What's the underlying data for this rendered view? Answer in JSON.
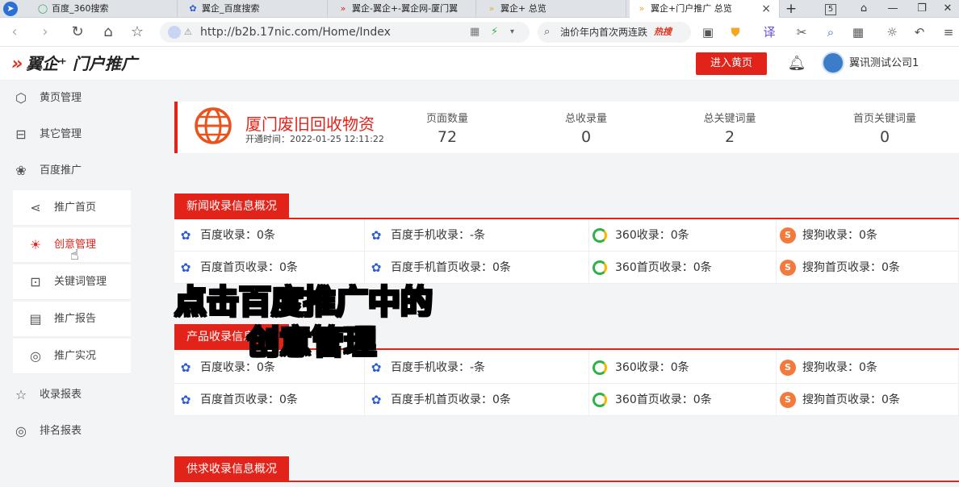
{
  "browser": {
    "tabs": [
      {
        "label": "百度_360搜索",
        "icon": "360-icon"
      },
      {
        "label": "翼企_百度搜索",
        "icon": "baidu-icon"
      },
      {
        "label": "翼企-翼企+-翼企网-厦门翼",
        "icon": "yiqi-icon"
      },
      {
        "label": "翼企+ 总览",
        "icon": "yiqi-icon"
      },
      {
        "label": "翼企+门户推广 总览",
        "icon": "yiqi-icon",
        "active": true
      }
    ],
    "tab_counter": "5",
    "url": "http://b2b.17nic.com/Home/Index",
    "search_text": "油价年内首次两连跌",
    "search_hot": "热搜"
  },
  "header": {
    "logo_text": "翼企⁺ 门户推广",
    "enter_button": "进入黄页",
    "username": "翼讯测试公司1"
  },
  "sidebar": {
    "items": [
      {
        "label": "黄页管理",
        "icon": "cube-icon"
      },
      {
        "label": "其它管理",
        "icon": "inbox-icon"
      },
      {
        "label": "百度推广",
        "icon": "paw-icon"
      },
      {
        "label": "推广首页",
        "icon": "share-icon",
        "sub": true
      },
      {
        "label": "创意管理",
        "icon": "lightbulb-icon",
        "sub": true,
        "active": true
      },
      {
        "label": "关键词管理",
        "icon": "search-box-icon",
        "sub": true
      },
      {
        "label": "推广报告",
        "icon": "clipboard-icon",
        "sub": true
      },
      {
        "label": "推广实况",
        "icon": "target-icon",
        "sub": true
      },
      {
        "label": "收录报表",
        "icon": "star-badge-icon"
      },
      {
        "label": "排名报表",
        "icon": "target-icon"
      }
    ]
  },
  "summary": {
    "company": "厦门废旧回收物资",
    "open_time": "开通时间：2022-01-25 12:11:22",
    "stats": [
      {
        "label": "页面数量",
        "value": "72"
      },
      {
        "label": "总收录量",
        "value": "0"
      },
      {
        "label": "总关键词量",
        "value": "2"
      },
      {
        "label": "首页关键词量",
        "value": "0"
      }
    ]
  },
  "sections": [
    {
      "title": "新闻收录信息概况",
      "rows": [
        [
          "百度收录：0条",
          "百度手机收录：-条",
          "360收录：0条",
          "搜狗收录：0条"
        ],
        [
          "百度首页收录：0条",
          "百度手机首页收录：0条",
          "360首页收录：0条",
          "搜狗首页收录：0条"
        ]
      ]
    },
    {
      "title": "产品收录信息概况",
      "rows": [
        [
          "百度收录：0条",
          "百度手机收录：-条",
          "360收录：0条",
          "搜狗收录：0条"
        ],
        [
          "百度首页收录：0条",
          "百度手机首页收录：0条",
          "360首页收录：0条",
          "搜狗首页收录：0条"
        ]
      ]
    },
    {
      "title": "供求收录信息概况"
    }
  ],
  "overlay": {
    "line1": "点击百度推广中的",
    "line2": "创意管理"
  },
  "colors": {
    "accent": "#e2231a",
    "sidebar_bg": "#f3f4f6",
    "overlay_text": "#ffeb00"
  }
}
